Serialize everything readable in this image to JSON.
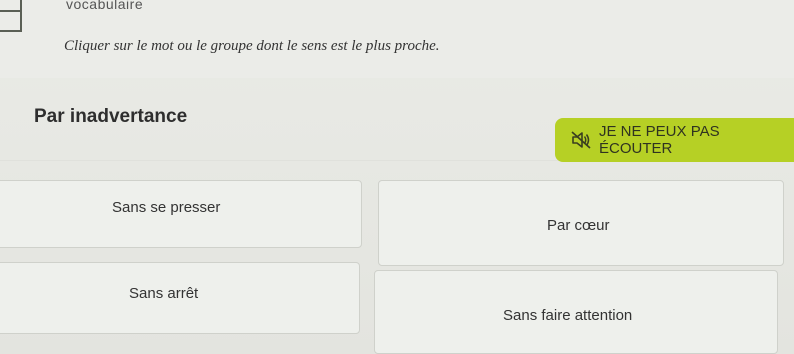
{
  "header": {
    "title": "vocabulaire",
    "logo_icon": "vocabulaire-logo-icon"
  },
  "exercise": {
    "instruction": "Cliquer sur le mot ou le groupe dont le sens est le plus proche.",
    "question": "Par inadvertance",
    "listen_button": {
      "icon": "speaker-muted-icon",
      "label": "JE NE PEUX PAS ÉCOUTER",
      "color": "#b6d025"
    },
    "answers": [
      {
        "label": "Sans se presser"
      },
      {
        "label": "Par cœur"
      },
      {
        "label": "Sans arrêt"
      },
      {
        "label": "Sans faire attention"
      }
    ]
  }
}
